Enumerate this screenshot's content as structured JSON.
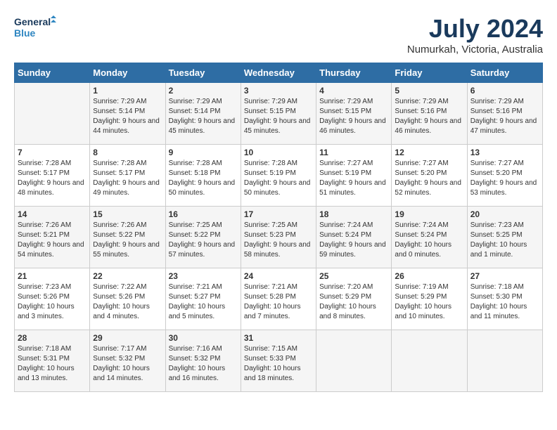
{
  "header": {
    "logo_line1": "General",
    "logo_line2": "Blue",
    "month_year": "July 2024",
    "location": "Numurkah, Victoria, Australia"
  },
  "weekdays": [
    "Sunday",
    "Monday",
    "Tuesday",
    "Wednesday",
    "Thursday",
    "Friday",
    "Saturday"
  ],
  "weeks": [
    [
      {
        "day": "",
        "sunrise": "",
        "sunset": "",
        "daylight": ""
      },
      {
        "day": "1",
        "sunrise": "Sunrise: 7:29 AM",
        "sunset": "Sunset: 5:14 PM",
        "daylight": "Daylight: 9 hours and 44 minutes."
      },
      {
        "day": "2",
        "sunrise": "Sunrise: 7:29 AM",
        "sunset": "Sunset: 5:14 PM",
        "daylight": "Daylight: 9 hours and 45 minutes."
      },
      {
        "day": "3",
        "sunrise": "Sunrise: 7:29 AM",
        "sunset": "Sunset: 5:15 PM",
        "daylight": "Daylight: 9 hours and 45 minutes."
      },
      {
        "day": "4",
        "sunrise": "Sunrise: 7:29 AM",
        "sunset": "Sunset: 5:15 PM",
        "daylight": "Daylight: 9 hours and 46 minutes."
      },
      {
        "day": "5",
        "sunrise": "Sunrise: 7:29 AM",
        "sunset": "Sunset: 5:16 PM",
        "daylight": "Daylight: 9 hours and 46 minutes."
      },
      {
        "day": "6",
        "sunrise": "Sunrise: 7:29 AM",
        "sunset": "Sunset: 5:16 PM",
        "daylight": "Daylight: 9 hours and 47 minutes."
      }
    ],
    [
      {
        "day": "7",
        "sunrise": "Sunrise: 7:28 AM",
        "sunset": "Sunset: 5:17 PM",
        "daylight": "Daylight: 9 hours and 48 minutes."
      },
      {
        "day": "8",
        "sunrise": "Sunrise: 7:28 AM",
        "sunset": "Sunset: 5:17 PM",
        "daylight": "Daylight: 9 hours and 49 minutes."
      },
      {
        "day": "9",
        "sunrise": "Sunrise: 7:28 AM",
        "sunset": "Sunset: 5:18 PM",
        "daylight": "Daylight: 9 hours and 50 minutes."
      },
      {
        "day": "10",
        "sunrise": "Sunrise: 7:28 AM",
        "sunset": "Sunset: 5:19 PM",
        "daylight": "Daylight: 9 hours and 50 minutes."
      },
      {
        "day": "11",
        "sunrise": "Sunrise: 7:27 AM",
        "sunset": "Sunset: 5:19 PM",
        "daylight": "Daylight: 9 hours and 51 minutes."
      },
      {
        "day": "12",
        "sunrise": "Sunrise: 7:27 AM",
        "sunset": "Sunset: 5:20 PM",
        "daylight": "Daylight: 9 hours and 52 minutes."
      },
      {
        "day": "13",
        "sunrise": "Sunrise: 7:27 AM",
        "sunset": "Sunset: 5:20 PM",
        "daylight": "Daylight: 9 hours and 53 minutes."
      }
    ],
    [
      {
        "day": "14",
        "sunrise": "Sunrise: 7:26 AM",
        "sunset": "Sunset: 5:21 PM",
        "daylight": "Daylight: 9 hours and 54 minutes."
      },
      {
        "day": "15",
        "sunrise": "Sunrise: 7:26 AM",
        "sunset": "Sunset: 5:22 PM",
        "daylight": "Daylight: 9 hours and 55 minutes."
      },
      {
        "day": "16",
        "sunrise": "Sunrise: 7:25 AM",
        "sunset": "Sunset: 5:22 PM",
        "daylight": "Daylight: 9 hours and 57 minutes."
      },
      {
        "day": "17",
        "sunrise": "Sunrise: 7:25 AM",
        "sunset": "Sunset: 5:23 PM",
        "daylight": "Daylight: 9 hours and 58 minutes."
      },
      {
        "day": "18",
        "sunrise": "Sunrise: 7:24 AM",
        "sunset": "Sunset: 5:24 PM",
        "daylight": "Daylight: 9 hours and 59 minutes."
      },
      {
        "day": "19",
        "sunrise": "Sunrise: 7:24 AM",
        "sunset": "Sunset: 5:24 PM",
        "daylight": "Daylight: 10 hours and 0 minutes."
      },
      {
        "day": "20",
        "sunrise": "Sunrise: 7:23 AM",
        "sunset": "Sunset: 5:25 PM",
        "daylight": "Daylight: 10 hours and 1 minute."
      }
    ],
    [
      {
        "day": "21",
        "sunrise": "Sunrise: 7:23 AM",
        "sunset": "Sunset: 5:26 PM",
        "daylight": "Daylight: 10 hours and 3 minutes."
      },
      {
        "day": "22",
        "sunrise": "Sunrise: 7:22 AM",
        "sunset": "Sunset: 5:26 PM",
        "daylight": "Daylight: 10 hours and 4 minutes."
      },
      {
        "day": "23",
        "sunrise": "Sunrise: 7:21 AM",
        "sunset": "Sunset: 5:27 PM",
        "daylight": "Daylight: 10 hours and 5 minutes."
      },
      {
        "day": "24",
        "sunrise": "Sunrise: 7:21 AM",
        "sunset": "Sunset: 5:28 PM",
        "daylight": "Daylight: 10 hours and 7 minutes."
      },
      {
        "day": "25",
        "sunrise": "Sunrise: 7:20 AM",
        "sunset": "Sunset: 5:29 PM",
        "daylight": "Daylight: 10 hours and 8 minutes."
      },
      {
        "day": "26",
        "sunrise": "Sunrise: 7:19 AM",
        "sunset": "Sunset: 5:29 PM",
        "daylight": "Daylight: 10 hours and 10 minutes."
      },
      {
        "day": "27",
        "sunrise": "Sunrise: 7:18 AM",
        "sunset": "Sunset: 5:30 PM",
        "daylight": "Daylight: 10 hours and 11 minutes."
      }
    ],
    [
      {
        "day": "28",
        "sunrise": "Sunrise: 7:18 AM",
        "sunset": "Sunset: 5:31 PM",
        "daylight": "Daylight: 10 hours and 13 minutes."
      },
      {
        "day": "29",
        "sunrise": "Sunrise: 7:17 AM",
        "sunset": "Sunset: 5:32 PM",
        "daylight": "Daylight: 10 hours and 14 minutes."
      },
      {
        "day": "30",
        "sunrise": "Sunrise: 7:16 AM",
        "sunset": "Sunset: 5:32 PM",
        "daylight": "Daylight: 10 hours and 16 minutes."
      },
      {
        "day": "31",
        "sunrise": "Sunrise: 7:15 AM",
        "sunset": "Sunset: 5:33 PM",
        "daylight": "Daylight: 10 hours and 18 minutes."
      },
      {
        "day": "",
        "sunrise": "",
        "sunset": "",
        "daylight": ""
      },
      {
        "day": "",
        "sunrise": "",
        "sunset": "",
        "daylight": ""
      },
      {
        "day": "",
        "sunrise": "",
        "sunset": "",
        "daylight": ""
      }
    ]
  ]
}
